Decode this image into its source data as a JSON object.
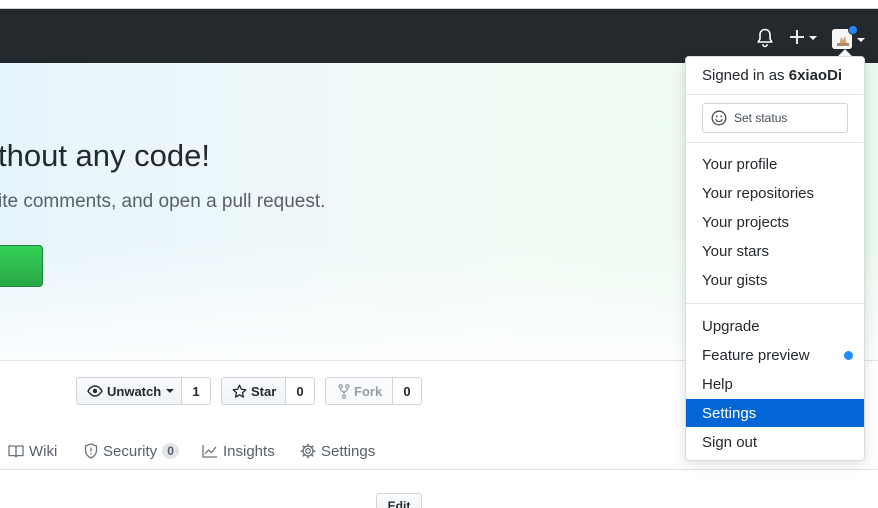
{
  "hero": {
    "title": "thout any code!",
    "subtitle": "ite comments, and open a pull request."
  },
  "repo_actions": {
    "unwatch_label": "Unwatch",
    "unwatch_count": "1",
    "star_label": "Star",
    "star_count": "0",
    "fork_label": "Fork",
    "fork_count": "0"
  },
  "tabs": [
    {
      "label": "Wiki",
      "icon": "book-icon"
    },
    {
      "label": "Security",
      "icon": "shield-icon",
      "counter": "0"
    },
    {
      "label": "Insights",
      "icon": "graph-icon"
    },
    {
      "label": "Settings",
      "icon": "gear-icon"
    }
  ],
  "edit_label": "Edit",
  "user_menu": {
    "signed_in_prefix": "Signed in as",
    "username": "6xiaoDi",
    "set_status": "Set status",
    "group1": [
      "Your profile",
      "Your repositories",
      "Your projects",
      "Your stars",
      "Your gists"
    ],
    "group2": [
      "Upgrade",
      "Feature preview",
      "Help",
      "Settings",
      "Sign out"
    ],
    "active_item": "Settings"
  },
  "colors": {
    "header_bg": "#24292e",
    "active_bg": "#0366d6",
    "notification_dot": "#2188ff",
    "hero_button": "#28a745"
  }
}
